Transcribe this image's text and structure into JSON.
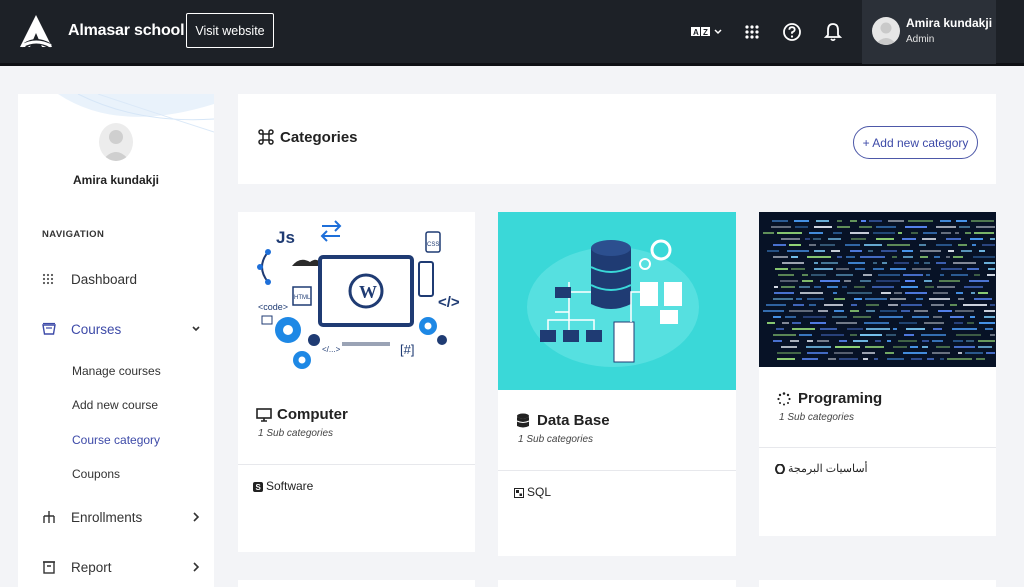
{
  "topbar": {
    "brand": "Almasar school",
    "visit_label": "Visit website",
    "icons": [
      "translate-icon",
      "grid-icon",
      "help-icon",
      "bell-icon"
    ],
    "user_name": "Amira kundakji",
    "user_role": "Admin"
  },
  "sidebar": {
    "profile_name": "Amira kundakji",
    "nav_title": "NAVIGATION",
    "items": [
      {
        "label": "Dashboard",
        "icon": "dashboard-grid-icon"
      },
      {
        "label": "Courses",
        "icon": "courses-icon",
        "expanded": true
      },
      {
        "label": "Enrollments",
        "icon": "enrollments-icon"
      },
      {
        "label": "Report",
        "icon": "report-icon"
      }
    ],
    "courses_sub": [
      {
        "label": "Manage courses"
      },
      {
        "label": "Add new course"
      },
      {
        "label": "Course category",
        "active": true
      },
      {
        "label": "Coupons"
      }
    ]
  },
  "main": {
    "title": "Categories",
    "add_label": "+ Add new category",
    "cards": [
      {
        "title": "Computer",
        "icon": "monitor-icon",
        "sub": "1 Sub categories",
        "tag": "Software",
        "image": "computer-illustration"
      },
      {
        "title": "Data Base",
        "icon": "database-icon",
        "sub": "1 Sub categories",
        "tag": "SQL",
        "image": "database-illustration"
      },
      {
        "title": "Programing",
        "icon": "spinner-icon",
        "sub": "1 Sub categories",
        "tag": "أساسيات البرمجة",
        "image": "code-screen-photo"
      }
    ]
  },
  "colors": {
    "topbar": "#1d2127",
    "accent": "#3d4aa8",
    "teal": "#3ad8d8"
  }
}
